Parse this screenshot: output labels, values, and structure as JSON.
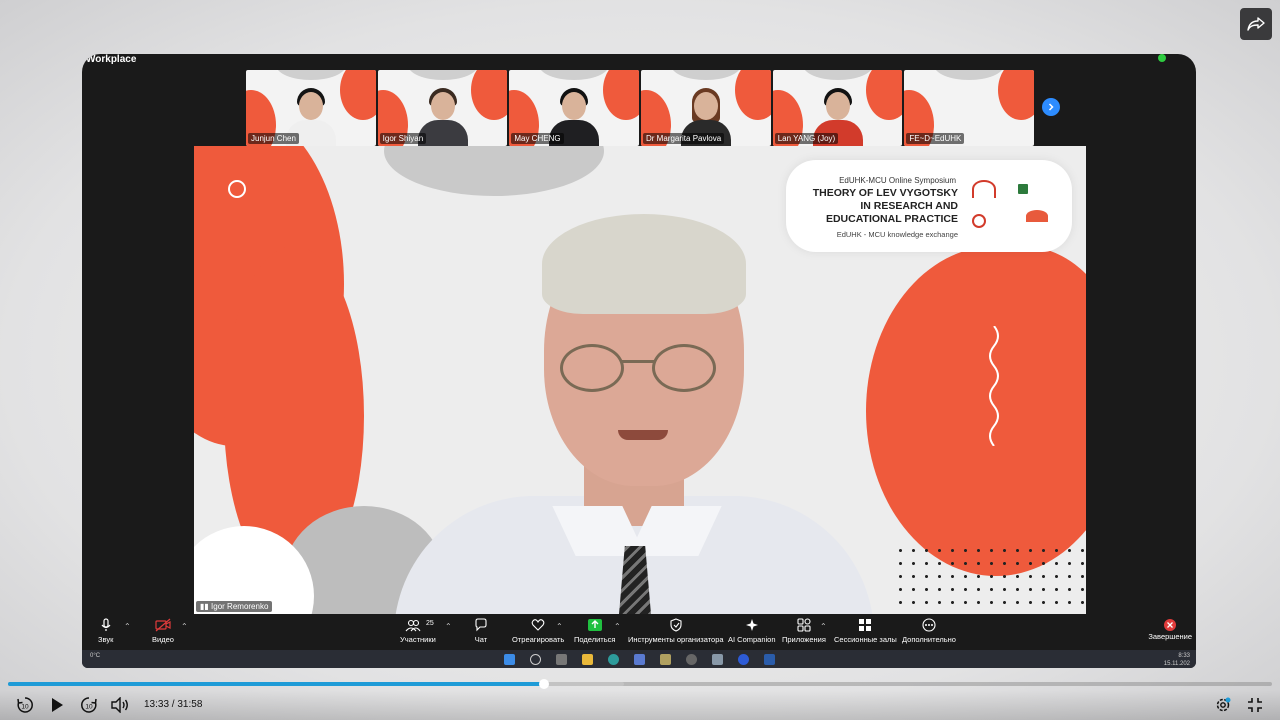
{
  "zoom": {
    "window_label": "Workplace",
    "participants": [
      {
        "name": "Junjun Chen",
        "hair": "#141414",
        "body": "#efefef"
      },
      {
        "name": "Igor Shiyan",
        "hair": "#3a2a20",
        "body": "#3b3b40"
      },
      {
        "name": "May CHENG",
        "hair": "#111111",
        "body": "#1f1f22"
      },
      {
        "name": "Dr Margarita Pavlova",
        "hair": "#6a3a22",
        "body": "#2a2a2a"
      },
      {
        "name": "Lan YANG (Joy)",
        "hair": "#121212",
        "body": "#d23b2b"
      },
      {
        "name": "FE~D~EdUHK",
        "hair": "",
        "body": ""
      }
    ],
    "banner": {
      "subtitle": "EdUHK-MCU Online Symposium",
      "title_line1": "THEORY OF LEV VYGOTSKY",
      "title_line2": "IN RESEARCH AND",
      "title_line3": "EDUCATIONAL PRACTICE",
      "footer": "EdUHK - MCU knowledge exchange"
    },
    "speaker_name": "Igor Remorenko",
    "toolbar": {
      "audio": "Звук",
      "video": "Видео",
      "participants": "Участники",
      "participants_count": "25",
      "chat": "Чат",
      "react": "Отреагировать",
      "share": "Поделиться",
      "host_tools": "Инструменты организатора",
      "ai_companion": "AI Companion",
      "apps": "Приложения",
      "breakout": "Сессионные залы",
      "more": "Дополнительно",
      "end": "Завершение"
    },
    "taskbar": {
      "weather_temp": "0°C",
      "clock_time": "8:33",
      "clock_date": "15.11.202"
    }
  },
  "player": {
    "time_display": "13:33 / 31:58",
    "progress_fraction": 0.424,
    "buffered_fraction": 0.487,
    "accent": "#1e9bd7"
  }
}
